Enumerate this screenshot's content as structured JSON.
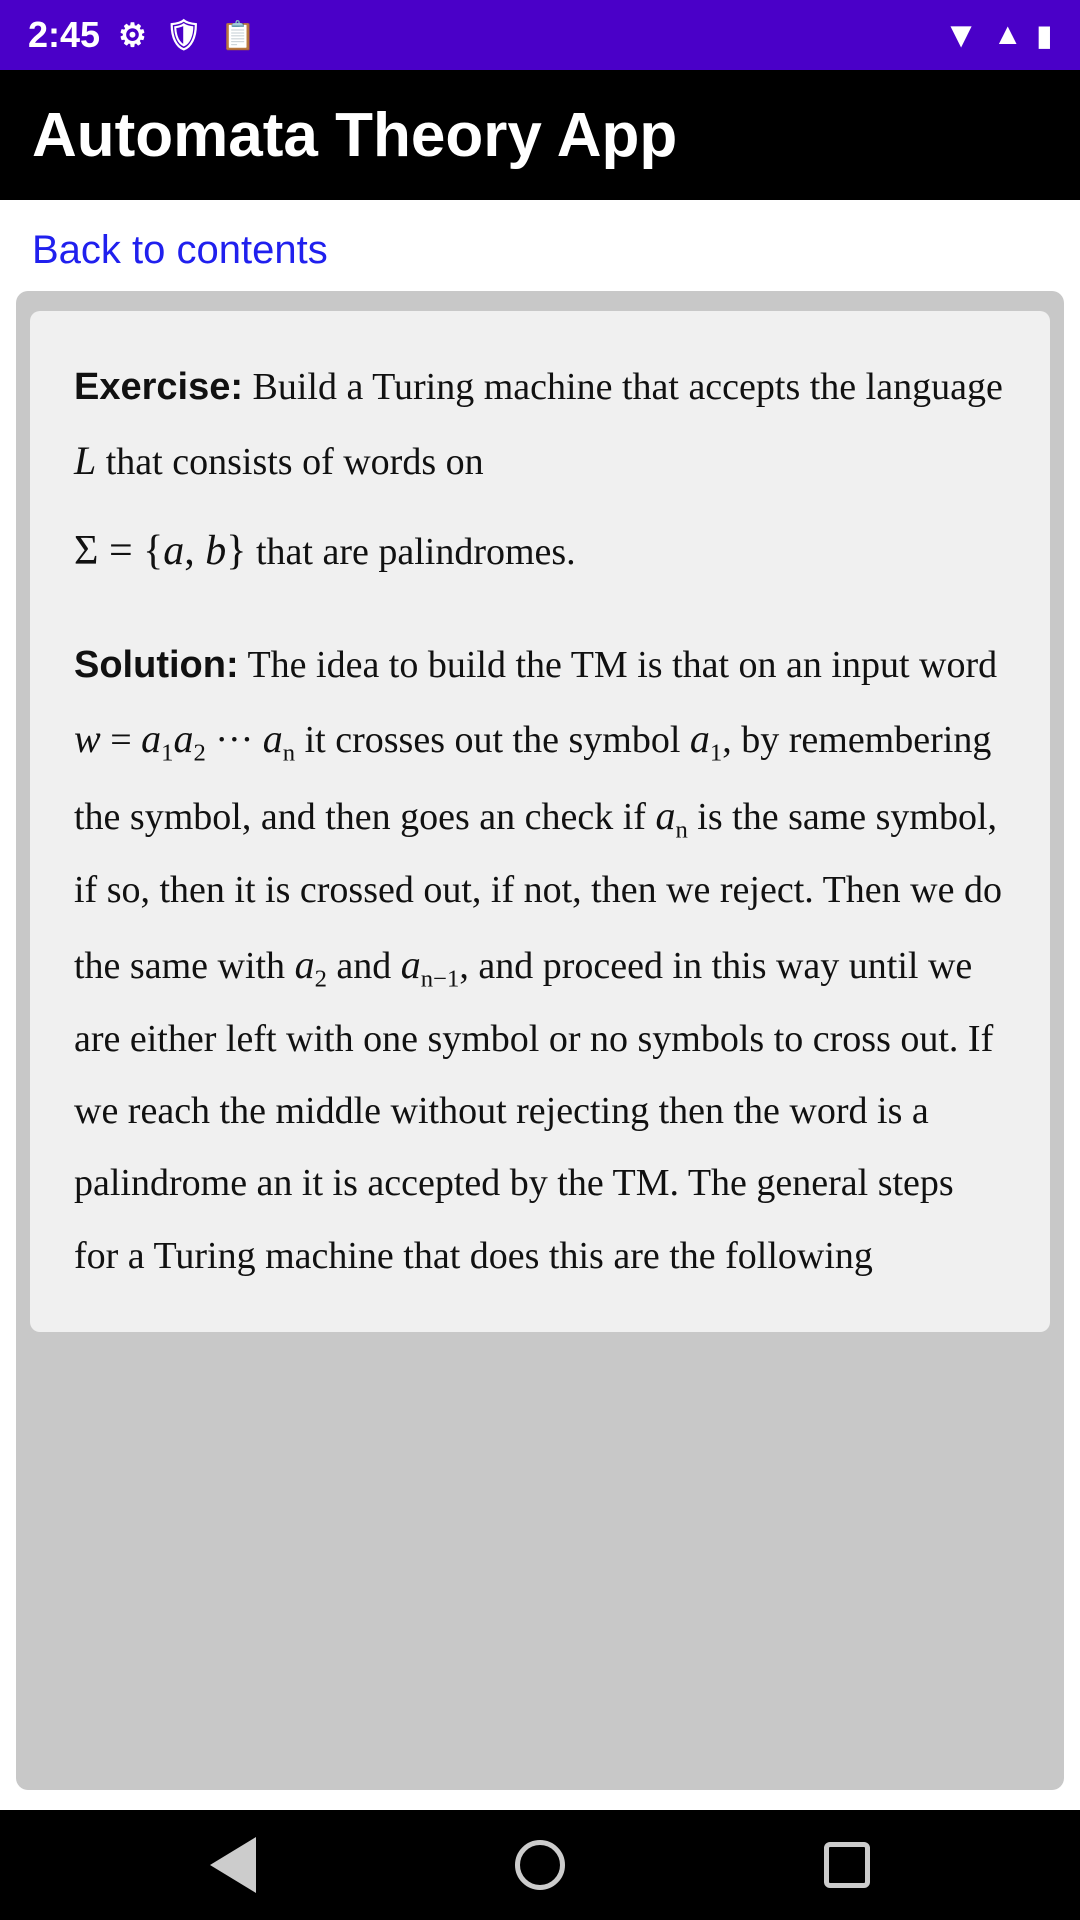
{
  "status": {
    "time": "2:45",
    "wifi_icon": "▼",
    "signal_icon": "▲",
    "battery_icon": "🔋"
  },
  "app_bar": {
    "title": "Automata Theory App"
  },
  "back_link": {
    "label": "Back to contents"
  },
  "content": {
    "exercise_label": "Exercise:",
    "exercise_text_1": " Build a Turing machine that accepts the language ",
    "exercise_L": "L",
    "exercise_text_2": " that consists of words on",
    "exercise_sigma": "Σ = {a, b}",
    "exercise_text_3": " that are palindromes.",
    "solution_label": "Solution:",
    "solution_text": " The idea to build the TM is that on an input word ",
    "solution_w": "w = a",
    "solution_w_sub1": "1",
    "solution_w_mid": "a",
    "solution_w_sub2": "2",
    "solution_w_dots": " ··· a",
    "solution_w_subn": "n",
    "solution_text2": " it crosses out the symbol a",
    "solution_a1_sub": "1",
    "solution_text3": ", by remembering the symbol, and then goes an check if a",
    "solution_an_sub": "n",
    "solution_text4": " is the same symbol, if so, then it is crossed out, if not, then we reject. Then we do the same with a",
    "solution_a2_sub": "2",
    "solution_text5": " and a",
    "solution_an1_sub": "n−1",
    "solution_text6": ", and proceed in this way until we are either left with one symbol or no symbols to cross out. If we reach the middle without rejecting then the word is a palindrome an it is accepted by the TM. The general steps for a Turing machine that does this are the following"
  },
  "bottom_nav": {
    "back_label": "back",
    "home_label": "home",
    "recent_label": "recent"
  }
}
